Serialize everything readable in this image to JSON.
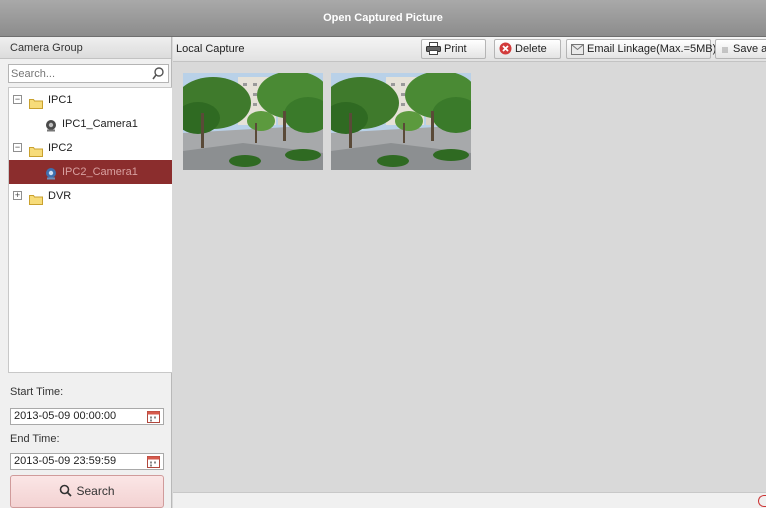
{
  "window": {
    "title": "Open Captured Picture"
  },
  "sidebar": {
    "header": "Camera Group",
    "search_placeholder": "Search...",
    "tree": [
      {
        "label": "IPC1",
        "type": "folder",
        "expanded": true
      },
      {
        "label": "IPC1_Camera1",
        "type": "camera"
      },
      {
        "label": "IPC2",
        "type": "folder",
        "expanded": true
      },
      {
        "label": "IPC2_Camera1",
        "type": "camera",
        "selected": true
      },
      {
        "label": "DVR",
        "type": "folder",
        "expanded": false
      }
    ],
    "start_time_label": "Start Time:",
    "start_time": "2013-05-09 00:00:00",
    "end_time_label": "End Time:",
    "end_time": "2013-05-09 23:59:59",
    "search_button": "Search"
  },
  "toolbar": {
    "title": "Local Capture",
    "print": "Print",
    "delete": "Delete",
    "email": "Email Linkage(Max.=5MB)",
    "save_as": "Save as"
  },
  "thumbnails": [
    {
      "name": "captured-picture-1"
    },
    {
      "name": "captured-picture-2"
    }
  ],
  "colors": {
    "selected_row": "#8b2d2d",
    "search_button": "#f3d2d2",
    "title_bar": "#9a9a9a",
    "delete_icon": "#d23b3b"
  }
}
